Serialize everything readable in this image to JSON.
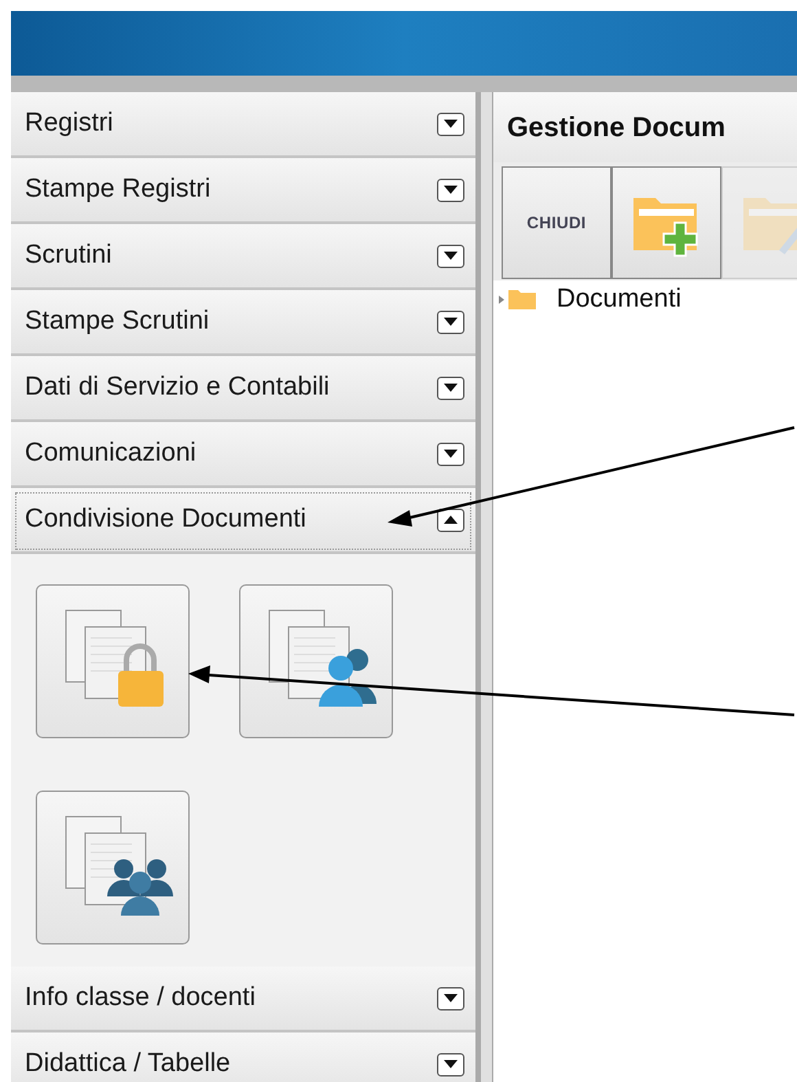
{
  "sidebar": {
    "sections": [
      {
        "label": "Registri",
        "expanded": false
      },
      {
        "label": "Stampe Registri",
        "expanded": false
      },
      {
        "label": "Scrutini",
        "expanded": false
      },
      {
        "label": "Stampe Scrutini",
        "expanded": false
      },
      {
        "label": "Dati di Servizio e Contabili",
        "expanded": false
      },
      {
        "label": "Comunicazioni",
        "expanded": false
      },
      {
        "label": "Condivisione Documenti",
        "expanded": true,
        "tiles": [
          {
            "kind": "lock"
          },
          {
            "kind": "user"
          },
          {
            "kind": "group"
          }
        ]
      },
      {
        "label": "Info classe / docenti",
        "expanded": false
      },
      {
        "label": "Didattica / Tabelle",
        "expanded": false
      }
    ]
  },
  "panel": {
    "title": "Gestione Docum",
    "toolbar": [
      {
        "kind": "text",
        "label": "CHIUDI",
        "disabled": false
      },
      {
        "kind": "new-folder",
        "disabled": false
      },
      {
        "kind": "edit-folder",
        "disabled": true
      }
    ],
    "tree": [
      {
        "label": "Documenti"
      }
    ]
  }
}
